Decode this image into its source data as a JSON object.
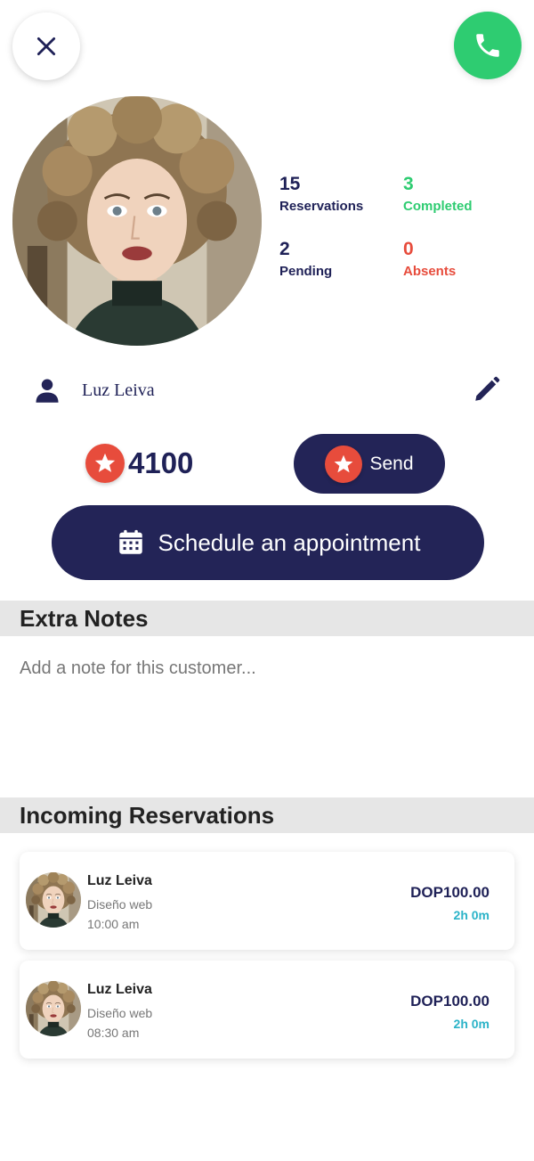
{
  "header": {
    "close_icon": "close-icon",
    "call_icon": "phone-icon"
  },
  "profile": {
    "stats": {
      "reservations": {
        "value": "15",
        "label": "Reservations"
      },
      "completed": {
        "value": "3",
        "label": "Completed"
      },
      "pending": {
        "value": "2",
        "label": "Pending"
      },
      "absents": {
        "value": "0",
        "label": "Absents"
      }
    },
    "name": "Luz Leiva"
  },
  "points": {
    "value": "4100",
    "send_label": "Send"
  },
  "schedule": {
    "label": "Schedule an appointment"
  },
  "notes": {
    "title": "Extra Notes",
    "placeholder": "Add a note for this customer..."
  },
  "reservations": {
    "title": "Incoming Reservations",
    "items": [
      {
        "name": "Luz Leiva",
        "service": "Diseño web",
        "time": "10:00 am",
        "price": "DOP100.00",
        "duration": "2h 0m"
      },
      {
        "name": "Luz Leiva",
        "service": "Diseño web",
        "time": "08:30 am",
        "price": "DOP100.00",
        "duration": "2h 0m"
      }
    ]
  },
  "colors": {
    "navy": "#232457",
    "green": "#2ecc71",
    "red": "#e74c3c",
    "teal": "#2bb3c8"
  }
}
